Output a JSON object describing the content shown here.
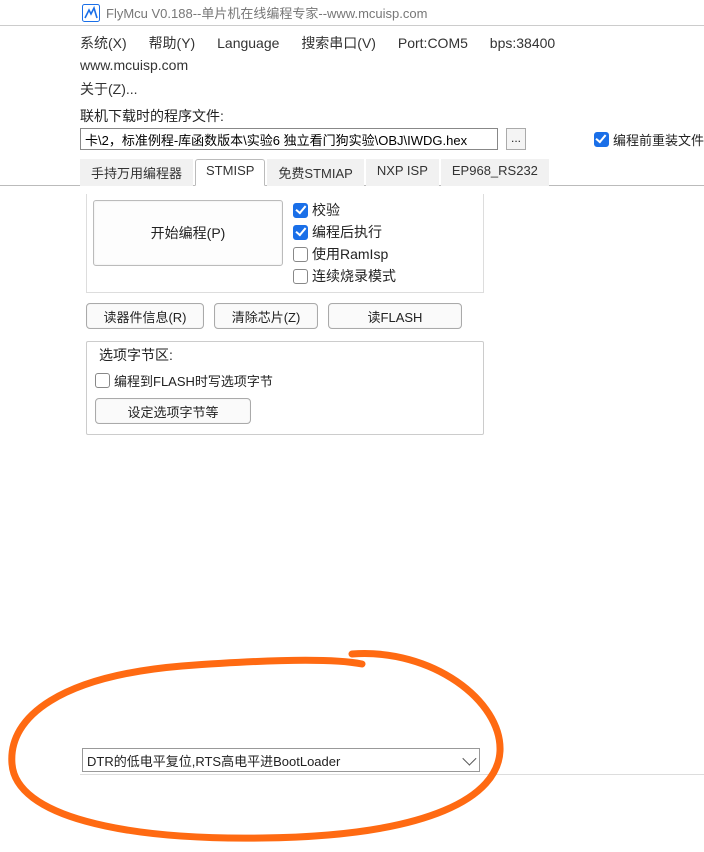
{
  "titlebar": {
    "title": "FlyMcu V0.188--单片机在线编程专家--www.mcuisp.com"
  },
  "menu": {
    "system": "系统(X)",
    "help": "帮助(Y)",
    "language": "Language",
    "search": "搜索串口(V)",
    "port": "Port:COM5",
    "baud": "bps:38400",
    "site": "www.mcuisp.com",
    "about": "关于(Z)..."
  },
  "file": {
    "label": "联机下载时的程序文件:",
    "path": "卡\\2，标准例程-库函数版本\\实验6 独立看门狗实验\\OBJ\\IWDG.hex",
    "browse": "...",
    "reload_label": "编程前重装文件",
    "reload_checked": true
  },
  "tabs": [
    {
      "id": "handheld",
      "label": "手持万用编程器",
      "active": false
    },
    {
      "id": "stmisp",
      "label": "STMISP",
      "active": true
    },
    {
      "id": "stmiap",
      "label": "免费STMIAP",
      "active": false
    },
    {
      "id": "nxpisp",
      "label": "NXP ISP",
      "active": false
    },
    {
      "id": "ep968",
      "label": "EP968_RS232",
      "active": false
    }
  ],
  "stmisp": {
    "start_btn": "开始编程(P)",
    "checks": {
      "verify": {
        "label": "校验",
        "checked": true
      },
      "runafter": {
        "label": "编程后执行",
        "checked": true
      },
      "ramisp": {
        "label": "使用RamIsp",
        "checked": false
      },
      "contburn": {
        "label": "连续烧录模式",
        "checked": false
      }
    },
    "btn_info": "读器件信息(R)",
    "btn_erase": "清除芯片(Z)",
    "btn_readf": "读FLASH",
    "optgroup_legend": "选项字节区:",
    "opt_write_label": "编程到FLASH时写选项字节",
    "opt_write_checked": false,
    "btn_setopt": "设定选项字节等"
  },
  "bootmode": {
    "selected": "DTR的低电平复位,RTS高电平进BootLoader"
  }
}
